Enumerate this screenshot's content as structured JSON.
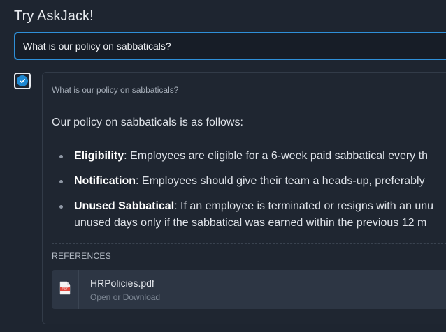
{
  "page": {
    "title": "Try AskJack!"
  },
  "search": {
    "value": "What is our policy on sabbaticals?"
  },
  "answer": {
    "question": "What is our policy on sabbaticals?",
    "intro": "Our policy on sabbaticals is as follows:",
    "bullets": [
      {
        "term": "Eligibility",
        "text": ": Employees are eligible for a 6-week paid sabbatical every th"
      },
      {
        "term": "Notification",
        "text": ": Employees should give their team a heads-up, preferably"
      },
      {
        "term": "Unused Sabbatical",
        "text": ": If an employee is terminated or resigns with an unu",
        "continuation": "unused days only if the sabbatical was earned within the previous 12 m"
      }
    ],
    "checkbox_checked": true
  },
  "references": {
    "label": "REFERENCES",
    "items": [
      {
        "filename": "HRPolicies.pdf",
        "open_label": "Open",
        "or_label": "or",
        "download_label": "Download",
        "icon": "pdf-file-icon"
      }
    ]
  },
  "colors": {
    "background": "#1e2530",
    "accent": "#1e88d1",
    "input_border": "#2f8fd8",
    "card_background": "#1f2631",
    "reference_background": "#2d3644",
    "pdf_red": "#e0483e"
  }
}
